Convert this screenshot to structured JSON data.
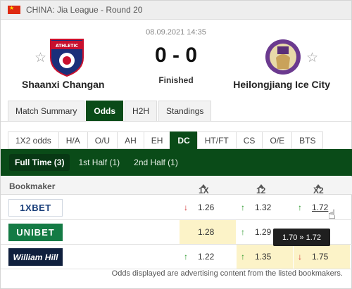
{
  "league": "CHINA: Jia League - Round 20",
  "match": {
    "datetime": "08.09.2021 14:35",
    "score": "0 - 0",
    "status": "Finished",
    "home_team": "Shaanxi Changan",
    "away_team": "Heilongjiang Ice City"
  },
  "tabs": [
    "Match Summary",
    "Odds",
    "H2H",
    "Standings"
  ],
  "markets": [
    "1X2 odds",
    "H/A",
    "O/U",
    "AH",
    "EH",
    "DC",
    "HT/FT",
    "CS",
    "O/E",
    "BTS"
  ],
  "halves": [
    "Full Time (3)",
    "1st Half (1)",
    "2nd Half (1)"
  ],
  "table": {
    "headers": {
      "bookmaker": "Bookmaker",
      "c1": "1X",
      "c2": "12",
      "c3": "X2"
    },
    "rows": [
      {
        "bookmaker": "1XBET",
        "c1": "1.26",
        "c2": "1.32",
        "c3": "1.72"
      },
      {
        "bookmaker": "UNIBET",
        "c1": "1.28",
        "c2": "1.29",
        "c3": ""
      },
      {
        "bookmaker": "William Hill",
        "c1": "1.22",
        "c2": "1.35",
        "c3": "1.75"
      }
    ]
  },
  "tooltip": "1.70 » 1.72",
  "footer": "Odds displayed are advertising content from the listed bookmakers.",
  "colors": {
    "primary": "#0a4b18",
    "highlight": "#fcf3c8",
    "up": "#2d9a2d",
    "down": "#d02b2b"
  }
}
